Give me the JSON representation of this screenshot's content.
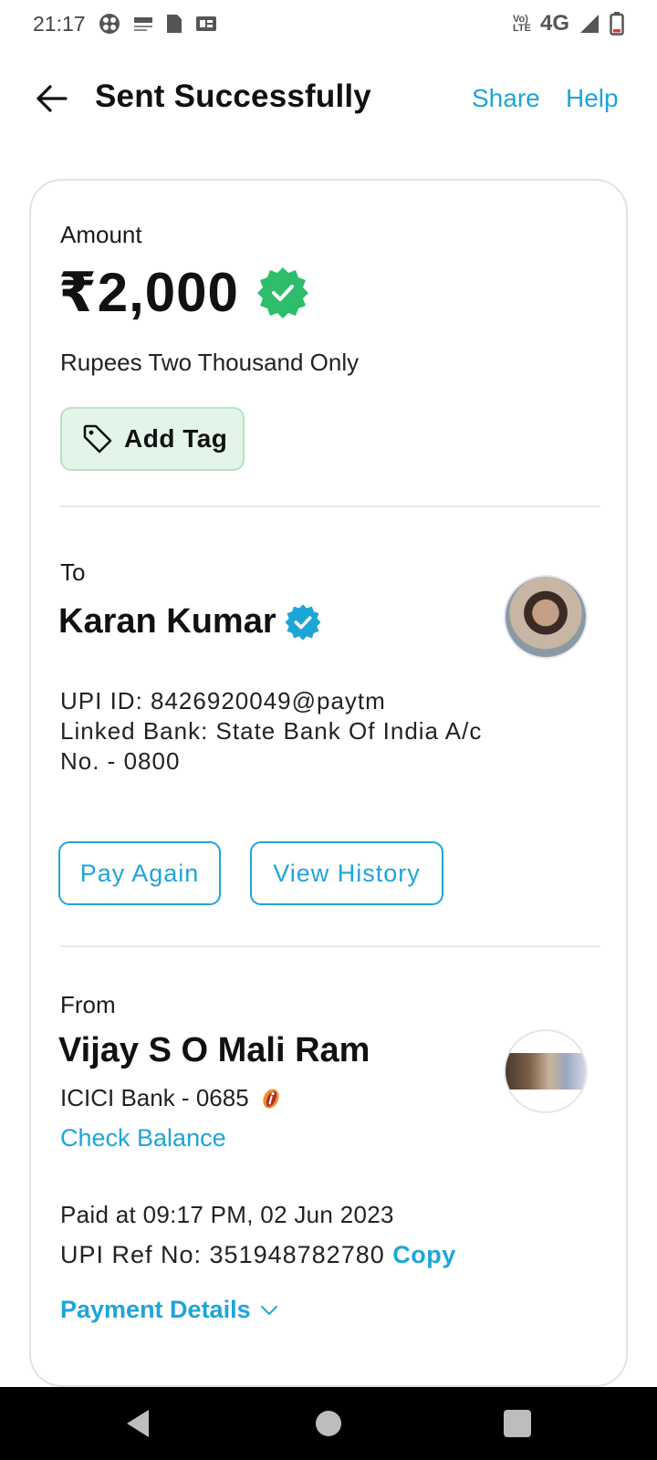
{
  "status_bar": {
    "time": "21:17",
    "left_icons": [
      "app-icon",
      "paytm-icon",
      "file-icon",
      "gallery-icon"
    ],
    "volte": "Vo\nLTE",
    "network": "4G",
    "right_icons": [
      "signal-icon",
      "battery-icon"
    ]
  },
  "header": {
    "title": "Sent Successfully",
    "share": "Share",
    "help": "Help",
    "back_icon": "arrow-left-icon"
  },
  "amount_section": {
    "label": "Amount",
    "value": "₹2,000",
    "words": "Rupees Two Thousand Only",
    "add_tag": "Add Tag",
    "success_color": "#2ebd6b"
  },
  "to_section": {
    "label": "To",
    "name": "Karan Kumar",
    "upi_id": "UPI ID: 8426920049@paytm",
    "linked_bank": "Linked Bank: State Bank Of India A/c",
    "account_no": "No. - 0800",
    "pay_again": "Pay Again",
    "view_history": "View History",
    "verified_color": "#1ea5d8"
  },
  "from_section": {
    "label": "From",
    "name": "Vijay S O Mali Ram",
    "bank": "ICICI Bank - 0685",
    "check_balance": "Check Balance"
  },
  "transaction": {
    "paid_at": "Paid at 09:17 PM, 02 Jun 2023",
    "upi_ref_label": "UPI Ref No: 351948782780",
    "copy": "Copy",
    "payment_details": "Payment Details"
  },
  "colors": {
    "accent": "#1ea5d8",
    "tag_bg": "#e3f5ea"
  }
}
